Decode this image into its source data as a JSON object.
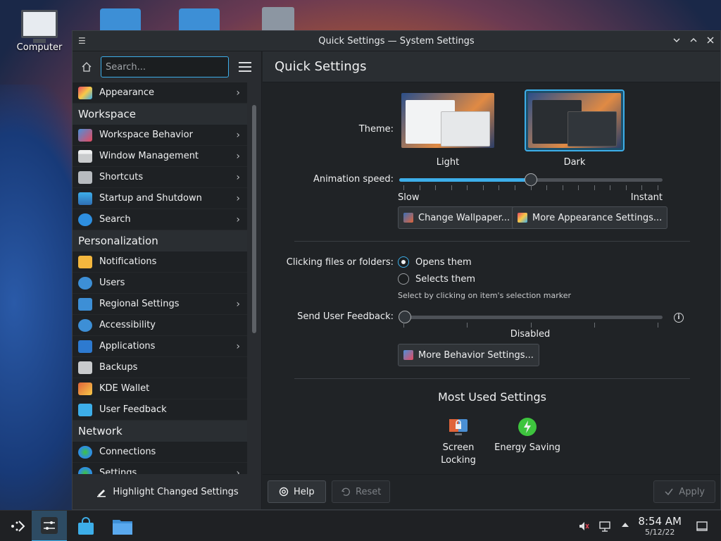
{
  "desktop": {
    "computer_label": "Computer"
  },
  "window": {
    "title": "Quick Settings — System Settings"
  },
  "sidebar": {
    "search_placeholder": "Search...",
    "items": [
      {
        "label": "Appearance",
        "has_arrow": true,
        "icon": "appearance-icon"
      },
      {
        "header": "Workspace"
      },
      {
        "label": "Workspace Behavior",
        "has_arrow": true,
        "icon": "workspace-behavior-icon"
      },
      {
        "label": "Window Management",
        "has_arrow": true,
        "icon": "window-management-icon"
      },
      {
        "label": "Shortcuts",
        "has_arrow": true,
        "icon": "keyboard-icon"
      },
      {
        "label": "Startup and Shutdown",
        "has_arrow": true,
        "icon": "startup-icon"
      },
      {
        "label": "Search",
        "has_arrow": true,
        "icon": "search-icon"
      },
      {
        "header": "Personalization"
      },
      {
        "label": "Notifications",
        "has_arrow": false,
        "icon": "bell-icon"
      },
      {
        "label": "Users",
        "has_arrow": false,
        "icon": "users-icon"
      },
      {
        "label": "Regional Settings",
        "has_arrow": true,
        "icon": "regional-icon"
      },
      {
        "label": "Accessibility",
        "has_arrow": false,
        "icon": "accessibility-icon"
      },
      {
        "label": "Applications",
        "has_arrow": true,
        "icon": "applications-icon"
      },
      {
        "label": "Backups",
        "has_arrow": false,
        "icon": "backups-icon"
      },
      {
        "label": "KDE Wallet",
        "has_arrow": false,
        "icon": "wallet-icon"
      },
      {
        "label": "User Feedback",
        "has_arrow": false,
        "icon": "feedback-icon"
      },
      {
        "header": "Network"
      },
      {
        "label": "Connections",
        "has_arrow": false,
        "icon": "globe-icon"
      },
      {
        "label": "Settings",
        "has_arrow": true,
        "icon": "globe-icon"
      }
    ],
    "highlight_button": "Highlight Changed Settings"
  },
  "main": {
    "title": "Quick Settings",
    "theme_label": "Theme:",
    "themes": [
      {
        "name": "Light",
        "selected": false
      },
      {
        "name": "Dark",
        "selected": true
      }
    ],
    "animation_label": "Animation speed:",
    "animation_min": "Slow",
    "animation_max": "Instant",
    "animation_value": 0.5,
    "change_wallpaper": "Change Wallpaper...",
    "more_appearance": "More Appearance Settings...",
    "clicking_label": "Clicking files or folders:",
    "click_options": [
      "Opens them",
      "Selects them"
    ],
    "click_selected": 0,
    "click_note": "Select by clicking on item's selection marker",
    "feedback_label": "Send User Feedback:",
    "feedback_value_text": "Disabled",
    "feedback_value": 0,
    "more_behavior": "More Behavior Settings...",
    "most_used_title": "Most Used Settings",
    "most_used": [
      {
        "label_line1": "Screen",
        "label_line2": "Locking"
      },
      {
        "label_line1": "Energy Saving",
        "label_line2": ""
      }
    ]
  },
  "footer": {
    "help": "Help",
    "reset": "Reset",
    "apply": "Apply"
  },
  "taskbar": {
    "time": "8:54 AM",
    "date": "5/12/22"
  },
  "colors": {
    "accent": "#3daee9",
    "window_bg": "#202326",
    "sidebar_bg": "#1e2124"
  }
}
